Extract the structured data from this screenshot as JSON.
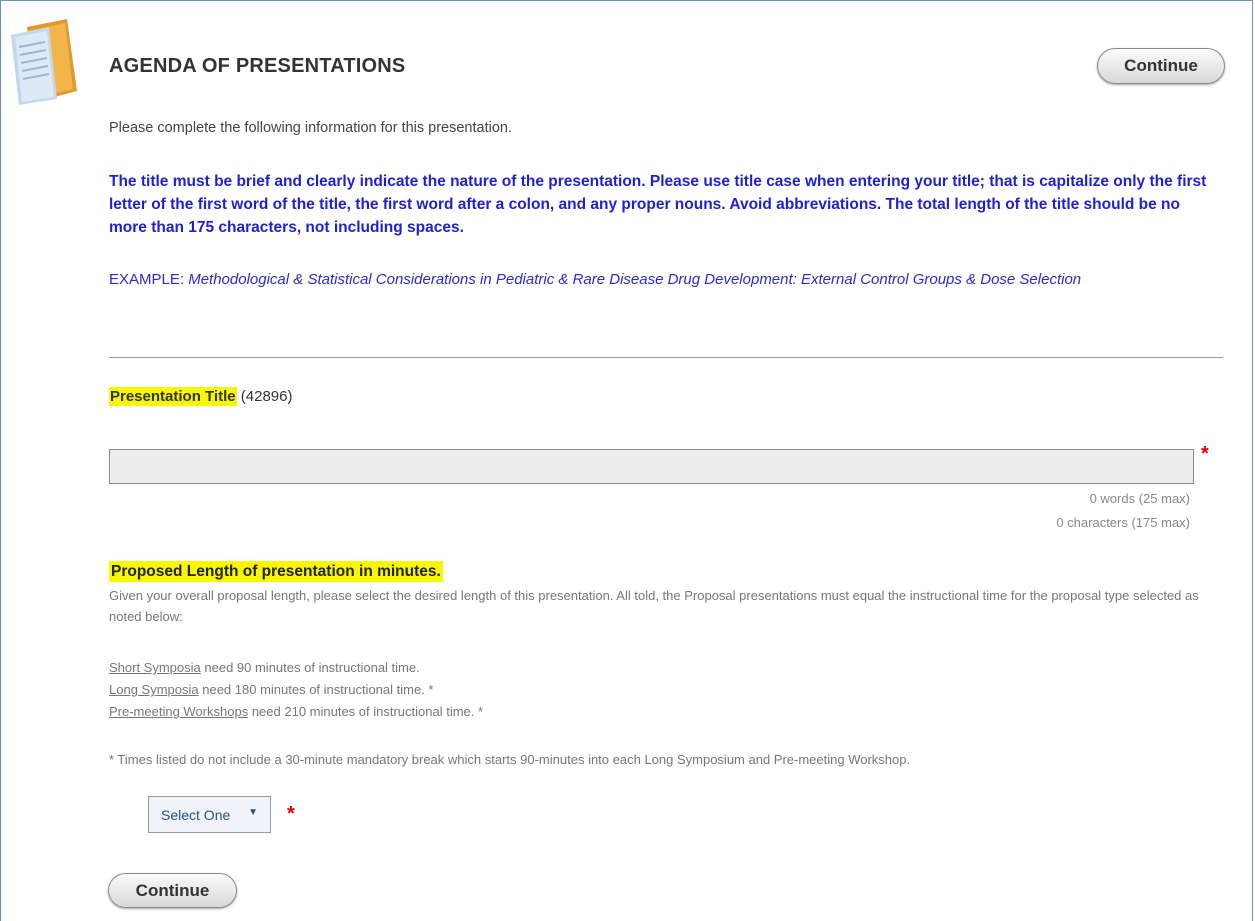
{
  "header": {
    "title": "AGENDA OF PRESENTATIONS",
    "continue_label": "Continue"
  },
  "intro": "Please complete the following information for this presentation.",
  "rules_text": "The title must be brief and clearly indicate the nature of the presentation. Please use title case when entering your title; that is capitalize only the first letter of the first word of the title, the first word after a colon, and any proper nouns. Avoid abbreviations. The total length of the title should be no more than 175 characters, not including spaces.",
  "example": {
    "prefix": "EXAMPLE: ",
    "text": "Methodological & Statistical Considerations in Pediatric & Rare Disease Drug Development: External Control Groups & Dose Selection"
  },
  "title_field": {
    "label": "Presentation Title",
    "id_text": "(42896)",
    "value": "",
    "required_mark": "*",
    "words_counter": "0 words (25 max)",
    "chars_counter": "0 characters (175 max)"
  },
  "length_field": {
    "label": "Proposed Length of presentation in minutes.",
    "description": "Given your overall proposal length, please select the desired length of this presentation. All told, the Proposal presentations must equal the instructional time for the proposal type selected as noted below:",
    "items": [
      {
        "link": "Short Symposia",
        "text": " need 90 minutes of instructional time."
      },
      {
        "link": "Long Symposia",
        "text": " need 180 minutes of instructional time. *"
      },
      {
        "link": "Pre-meeting Workshops",
        "text": " need 210 minutes of instructional time. *"
      }
    ],
    "note": "* Times listed do not include a 30-minute mandatory break which starts 90-minutes into each Long Symposium and Pre-meeting Workshop.",
    "select_value": "Select One",
    "required_mark": "*"
  },
  "footer": {
    "continue_label": "Continue"
  },
  "colors": {
    "instruction_blue": "#1f1fd6",
    "highlight": "#f7f700",
    "required": "#e00000"
  }
}
